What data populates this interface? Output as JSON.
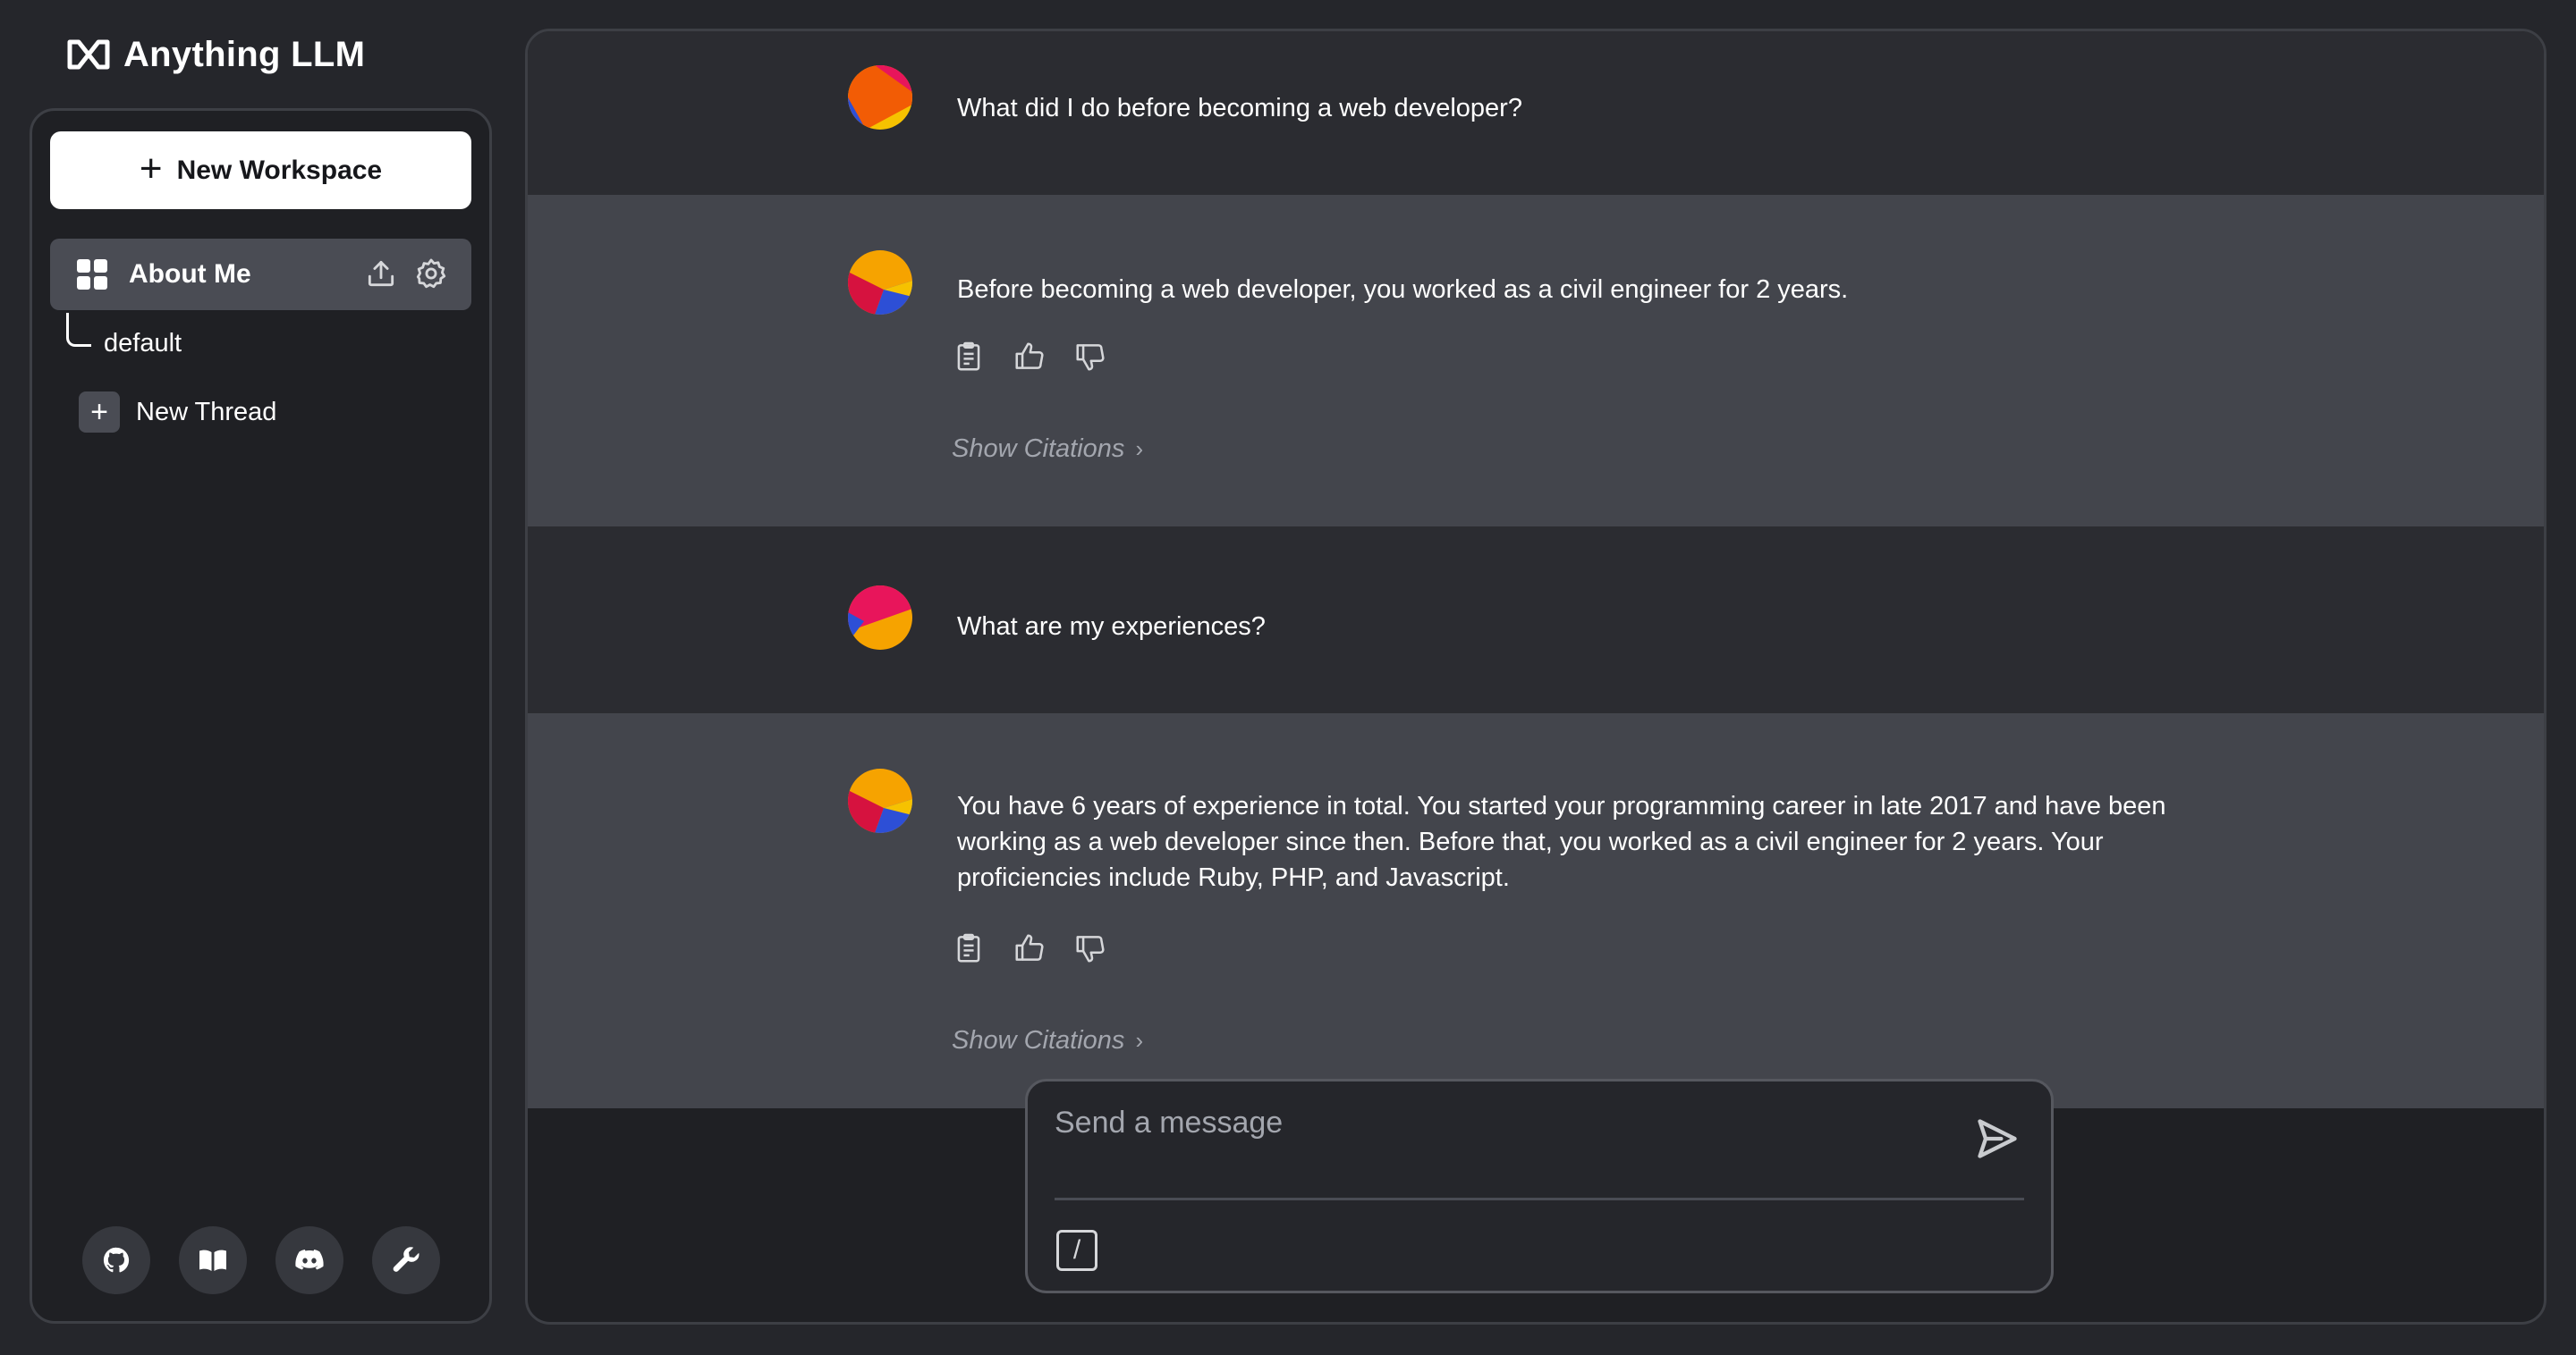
{
  "app": {
    "name": "Anything LLM"
  },
  "sidebar": {
    "new_workspace_label": "New Workspace",
    "workspace": {
      "name": "About Me"
    },
    "thread_default": "default",
    "new_thread_label": "New Thread",
    "footer_icons": [
      "github-icon",
      "docs-book-icon",
      "discord-icon",
      "wrench-icon"
    ]
  },
  "chat": {
    "messages": [
      {
        "role": "user",
        "text": "What did I do before becoming a web developer?"
      },
      {
        "role": "assistant",
        "text": "Before becoming a web developer, you worked as a civil engineer for 2 years.",
        "citations_label": "Show Citations"
      },
      {
        "role": "user",
        "text": "What are my experiences?"
      },
      {
        "role": "assistant",
        "text": "You have 6 years of experience in total. You started your programming career in late 2017 and have been working as a web developer since then. Before that, you worked as a civil engineer for 2 years. Your proficiencies include Ruby, PHP, and Javascript.",
        "citations_label": "Show Citations"
      }
    ]
  },
  "composer": {
    "placeholder": "Send a message",
    "slash_label": "/"
  },
  "colors": {
    "background": "#25262b",
    "panel": "#1f2024",
    "user_row": "#2b2c31",
    "assistant_row": "#43454c",
    "accent_text": "#a3a6ae"
  }
}
